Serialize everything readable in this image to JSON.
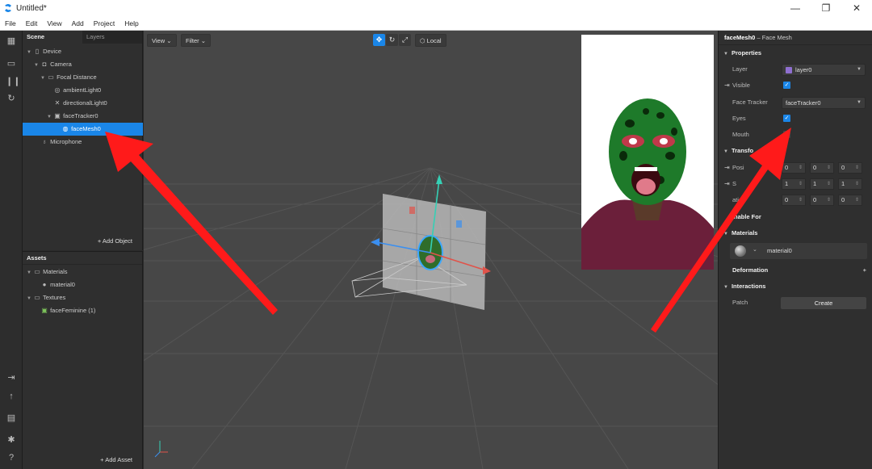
{
  "window": {
    "title": "Untitled*",
    "minimize": "—",
    "maximize": "❐",
    "close": "✕"
  },
  "menu": [
    "File",
    "Edit",
    "View",
    "Add",
    "Project",
    "Help"
  ],
  "scene_panel": {
    "tabs": [
      "Scene",
      "Layers"
    ],
    "tree": [
      {
        "label": "Device",
        "icon": "phone-icon",
        "depth": 0,
        "expanded": true
      },
      {
        "label": "Camera",
        "icon": "camera-icon",
        "depth": 1,
        "expanded": true
      },
      {
        "label": "Focal Distance",
        "icon": "focal-icon",
        "depth": 2,
        "expanded": true
      },
      {
        "label": "ambientLight0",
        "icon": "light-icon",
        "depth": 3
      },
      {
        "label": "directionalLight0",
        "icon": "directional-light-icon",
        "depth": 3
      },
      {
        "label": "faceTracker0",
        "icon": "face-tracker-icon",
        "depth": 3,
        "expanded": true
      },
      {
        "label": "faceMesh0",
        "icon": "face-mesh-icon",
        "depth": 4,
        "selected": true
      },
      {
        "label": "Microphone",
        "icon": "microphone-icon",
        "depth": 1
      }
    ],
    "add_object": "+ Add Object"
  },
  "assets_panel": {
    "title": "Assets",
    "tree": [
      {
        "label": "Materials",
        "icon": "folder-icon",
        "depth": 0,
        "expanded": true
      },
      {
        "label": "material0",
        "icon": "material-sphere-icon",
        "depth": 1
      },
      {
        "label": "Textures",
        "icon": "folder-icon",
        "depth": 0,
        "expanded": true
      },
      {
        "label": "faceFeminine (1)",
        "icon": "texture-icon",
        "depth": 1
      }
    ],
    "add_asset": "+ Add Asset"
  },
  "viewport": {
    "view_label": "View",
    "filter_label": "Filter",
    "local_label": "Local"
  },
  "properties": {
    "object_name": "faceMesh0",
    "object_type": " – Face Mesh",
    "sections": {
      "properties": "Properties",
      "transform": "Transfo",
      "enable_for": "Enable For",
      "materials": "Materials",
      "deformation": "Deformation",
      "interactions": "Interactions"
    },
    "layer_label": "Layer",
    "layer_value": "layer0",
    "visible_label": "Visible",
    "face_tracker_label": "Face Tracker",
    "face_tracker_value": "faceTracker0",
    "eyes_label": "Eyes",
    "mouth_label": "Mouth",
    "position_label": "Posi",
    "scale_label": "S",
    "rotation_label": "ation",
    "position": [
      "0",
      "0",
      "0"
    ],
    "scale": [
      "1",
      "1",
      "1"
    ],
    "rotation": [
      "0",
      "0",
      "0"
    ],
    "material_value": "material0",
    "patch_label": "Patch",
    "create_label": "Create",
    "deformation_plus": "+"
  },
  "colors": {
    "accent": "#1a86e8",
    "annotation_arrow": "#ff1a1a",
    "layer_swatch": "#8f6fd0"
  }
}
